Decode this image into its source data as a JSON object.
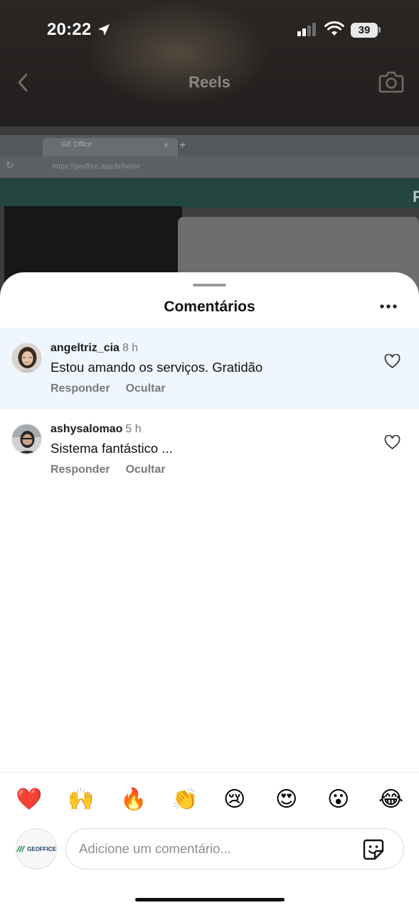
{
  "status_bar": {
    "time": "20:22",
    "battery": "39"
  },
  "reel": {
    "title": "Reels",
    "browser_tab": "GE Office",
    "browser_url": "https://geoffice.app.br/home",
    "site_letter": "F"
  },
  "sheet": {
    "title": "Comentários",
    "comments": [
      {
        "username": "angeltriz_cia",
        "time": "8 h",
        "text": "Estou amando os serviços. Gratidão",
        "reply_label": "Responder",
        "hide_label": "Ocultar"
      },
      {
        "username": "ashysalomao",
        "time": "5 h",
        "text": "Sistema fantástico ...",
        "reply_label": "Responder",
        "hide_label": "Ocultar"
      }
    ],
    "emojis": [
      "❤️",
      "🙌",
      "🔥",
      "👏",
      "😢",
      "😍",
      "😮",
      "😂"
    ],
    "composer": {
      "placeholder": "Adicione um comentário...",
      "avatar_logo": "GEOFFICE"
    }
  },
  "colors": {
    "highlight_row": "#eff6fd",
    "secondary_text": "#7a7a7a"
  }
}
